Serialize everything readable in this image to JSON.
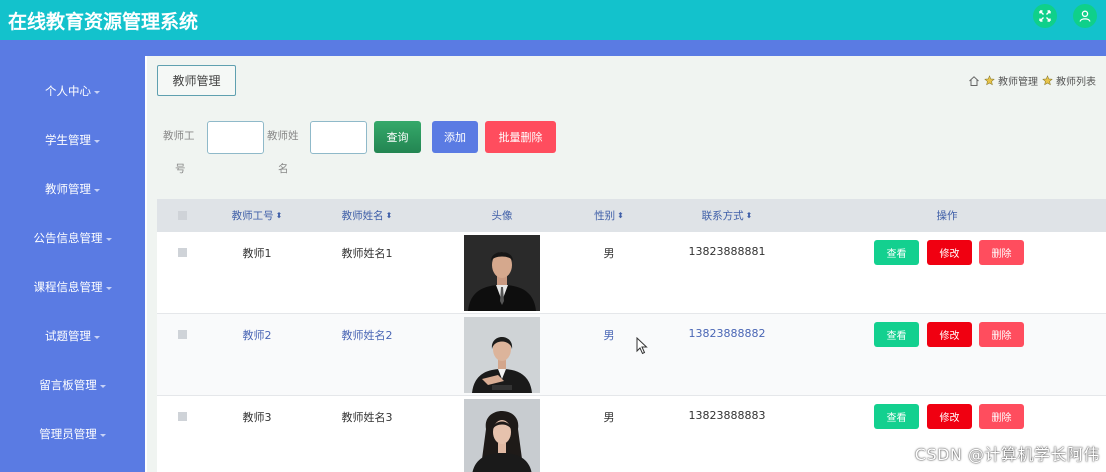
{
  "app": {
    "title": "在线教育资源管理系统"
  },
  "header_icons": [
    "expand-icon",
    "user-icon"
  ],
  "sidebar": {
    "items": [
      {
        "label": "个人中心"
      },
      {
        "label": "学生管理"
      },
      {
        "label": "教师管理"
      },
      {
        "label": "公告信息管理"
      },
      {
        "label": "课程信息管理"
      },
      {
        "label": "试题管理"
      },
      {
        "label": "留言板管理"
      },
      {
        "label": "管理员管理"
      }
    ]
  },
  "page": {
    "title": "教师管理"
  },
  "breadcrumb": {
    "items": [
      "教师管理",
      "教师列表"
    ]
  },
  "search": {
    "teacher_id_label_1": "教师工",
    "teacher_id_label_2": "号",
    "teacher_id_value": "",
    "teacher_name_label_1": "教师姓",
    "teacher_name_label_2": "名",
    "teacher_name_value": "",
    "query_label": "查询",
    "add_label": "添加",
    "batch_delete_label": "批量删除"
  },
  "table": {
    "columns": [
      "教师工号",
      "教师姓名",
      "头像",
      "性别",
      "联系方式",
      "操作"
    ],
    "rows": [
      {
        "teacher_id": "教师1",
        "teacher_name": "教师姓名1",
        "gender": "男",
        "phone": "13823888881"
      },
      {
        "teacher_id": "教师2",
        "teacher_name": "教师姓名2",
        "gender": "男",
        "phone": "13823888882"
      },
      {
        "teacher_id": "教师3",
        "teacher_name": "教师姓名3",
        "gender": "男",
        "phone": "13823888883"
      }
    ],
    "actions": {
      "view": "查看",
      "edit": "修改",
      "delete": "删除"
    }
  },
  "watermark": "CSDN @计算机学长阿伟",
  "colors": {
    "topbar": "#13c2cc",
    "sidebar": "#5a7be3",
    "query": "#2f9e5f",
    "add": "#5a7be3",
    "batch_delete": "#ff4d5e",
    "view": "#13d08f",
    "edit": "#f00011",
    "delete": "#ff4d5e"
  }
}
